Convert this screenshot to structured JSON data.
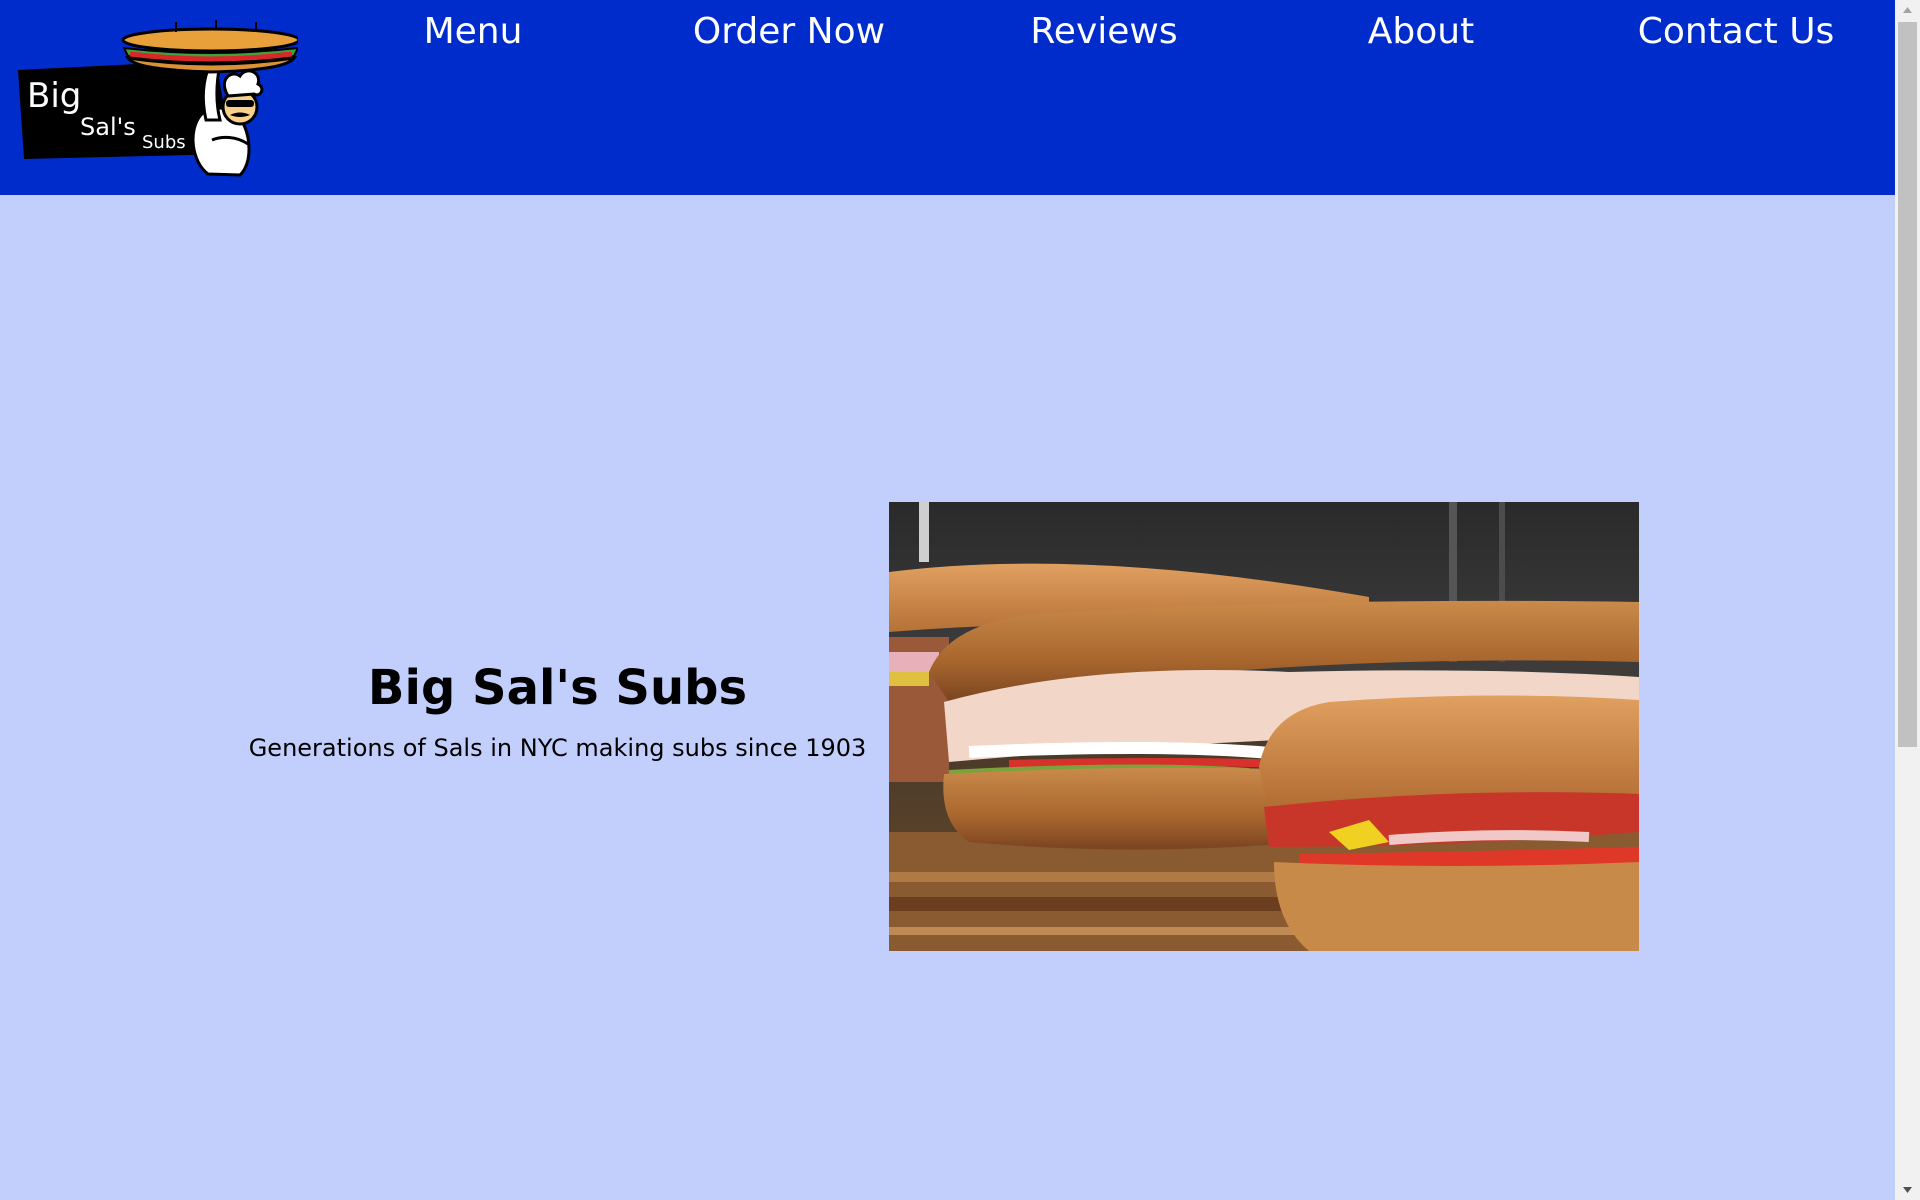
{
  "logo": {
    "text_line1": "Big",
    "text_line2": "Sal's",
    "text_line3": "Subs",
    "icon": "chef-holding-sub-logo"
  },
  "nav": {
    "items": [
      {
        "label": "Menu"
      },
      {
        "label": "Order Now"
      },
      {
        "label": "Reviews"
      },
      {
        "label": "About"
      },
      {
        "label": "Contact Us"
      }
    ]
  },
  "hero": {
    "title": "Big Sal's Subs",
    "subtitle": "Generations of Sals in NYC making subs since 1903",
    "image": "submarine-sandwiches-photo"
  },
  "colors": {
    "nav_background": "#002ccb",
    "page_background": "#c2cffc",
    "nav_text": "#ffffff",
    "body_text": "#000000"
  },
  "scrollbar": {
    "up_icon": "scroll-up-arrow-icon",
    "down_icon": "scroll-down-arrow-icon"
  }
}
